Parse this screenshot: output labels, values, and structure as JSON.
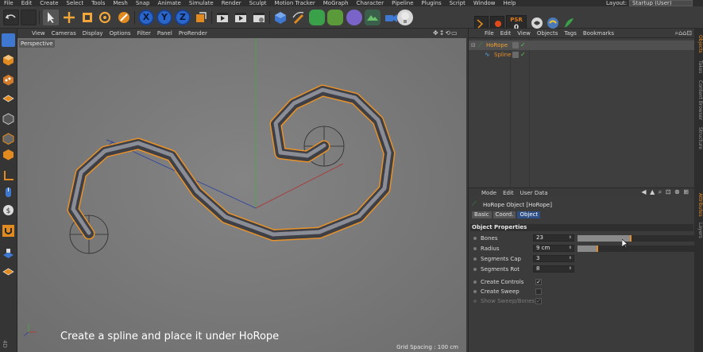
{
  "menubar": {
    "items": [
      "File",
      "Edit",
      "Create",
      "Select",
      "Tools",
      "Mesh",
      "Snap",
      "Animate",
      "Simulate",
      "Render",
      "Sculpt",
      "Motion Tracker",
      "MoGraph",
      "Character",
      "Pipeline",
      "Plugins",
      "Script",
      "Window",
      "Help"
    ],
    "layout_label": "Layout:",
    "layout_value": "Startup (User)"
  },
  "toolbar": {
    "axis_x": "X",
    "axis_y": "Y",
    "axis_z": "Z",
    "psr_label": "PSR",
    "psr_value": "0"
  },
  "viewport": {
    "menu": [
      "View",
      "Cameras",
      "Display",
      "Options",
      "Filter",
      "Panel",
      "ProRender"
    ],
    "label": "Perspective",
    "grid_spacing": "Grid Spacing : 100 cm",
    "caption": "Create a spline and place it under HoRope",
    "corner_text": "4D"
  },
  "object_manager": {
    "menu": [
      "File",
      "Edit",
      "View",
      "Objects",
      "Tags",
      "Bookmarks"
    ],
    "objects": [
      {
        "name": "HoRope",
        "selected": true
      },
      {
        "name": "Spline",
        "selected": false
      }
    ]
  },
  "attribute_manager": {
    "menu": [
      "Mode",
      "Edit",
      "User Data"
    ],
    "title": "HoRope Object [HoRope]",
    "tabs": [
      "Basic",
      "Coord.",
      "Object"
    ],
    "active_tab": "Object",
    "section": "Object Properties",
    "props": {
      "bones": {
        "label": "Bones",
        "value": "23",
        "slider_fraction": 0.45
      },
      "radius": {
        "label": "Radius",
        "value": "9 cm",
        "slider_fraction": 0.17
      },
      "segments_cap": {
        "label": "Segments Cap",
        "value": "3"
      },
      "segments_rot": {
        "label": "Segments Rot",
        "value": "8"
      },
      "create_controls": {
        "label": "Create Controls",
        "checked": true
      },
      "create_sweep": {
        "label": "Create Sweep",
        "checked": false
      },
      "show_sweep_bones": {
        "label": "Show Sweep/Bones",
        "checked": true
      }
    }
  },
  "right_strip_tabs": [
    "Objects",
    "Takes",
    "Content Browser",
    "Structure",
    "Attributes",
    "Layers"
  ],
  "colors": {
    "accent_orange": "#e58d2a",
    "axis_blue": "#2a66c9",
    "selected_tab": "#2e4f86",
    "viewport_bg": "#7a7a7a"
  }
}
